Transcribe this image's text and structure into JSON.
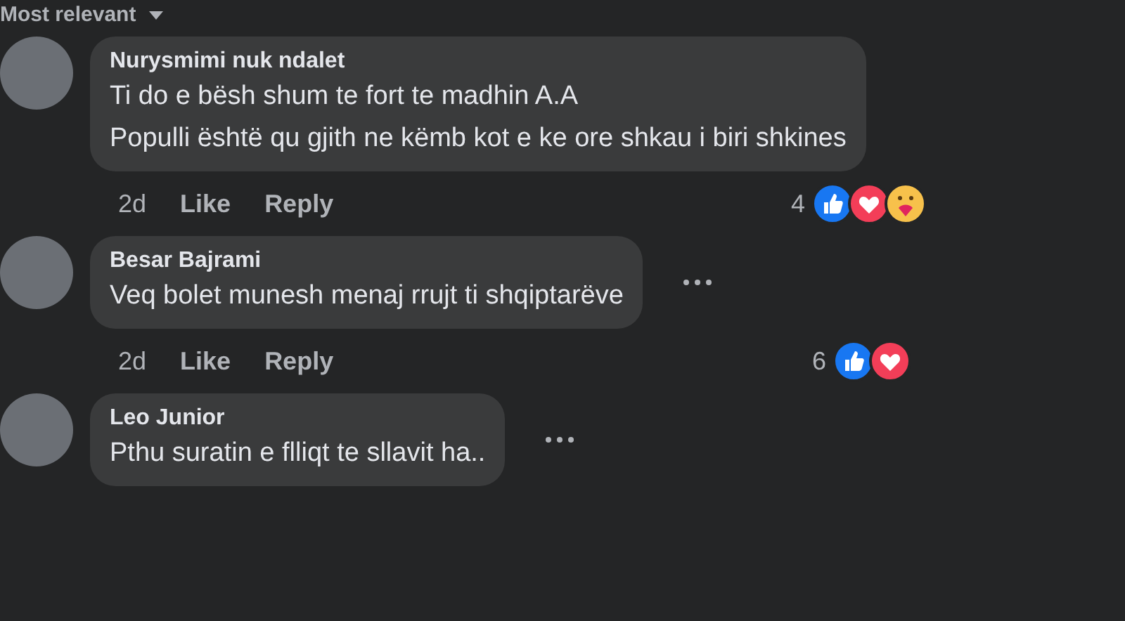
{
  "sort": {
    "label": "Most relevant"
  },
  "comments": [
    {
      "author": "Nurysmimi nuk ndalet",
      "lines": [
        "Ti do e bësh shum te fort te madhin A.A",
        "Populli është qu gjith ne këmb kot e ke ore shkau i biri shkines"
      ],
      "time": "2d",
      "actions": [
        "Like",
        "Reply"
      ],
      "reaction_count": "4",
      "reactions": [
        {
          "kind": "like"
        },
        {
          "kind": "love"
        },
        {
          "kind": "care"
        }
      ],
      "more": false
    },
    {
      "author": "Besar Bajrami",
      "lines": [
        "Veq bolet munesh menaj rrujt ti shqiptarëve"
      ],
      "time": "2d",
      "actions": [
        "Like",
        "Reply"
      ],
      "reaction_count": "6",
      "reactions": [
        {
          "kind": "like"
        },
        {
          "kind": "love"
        }
      ],
      "more": true
    },
    {
      "author": "Leo Junior",
      "lines": [
        "Pthu suratin e flliqt te sllavit ha.."
      ],
      "more": true
    }
  ]
}
